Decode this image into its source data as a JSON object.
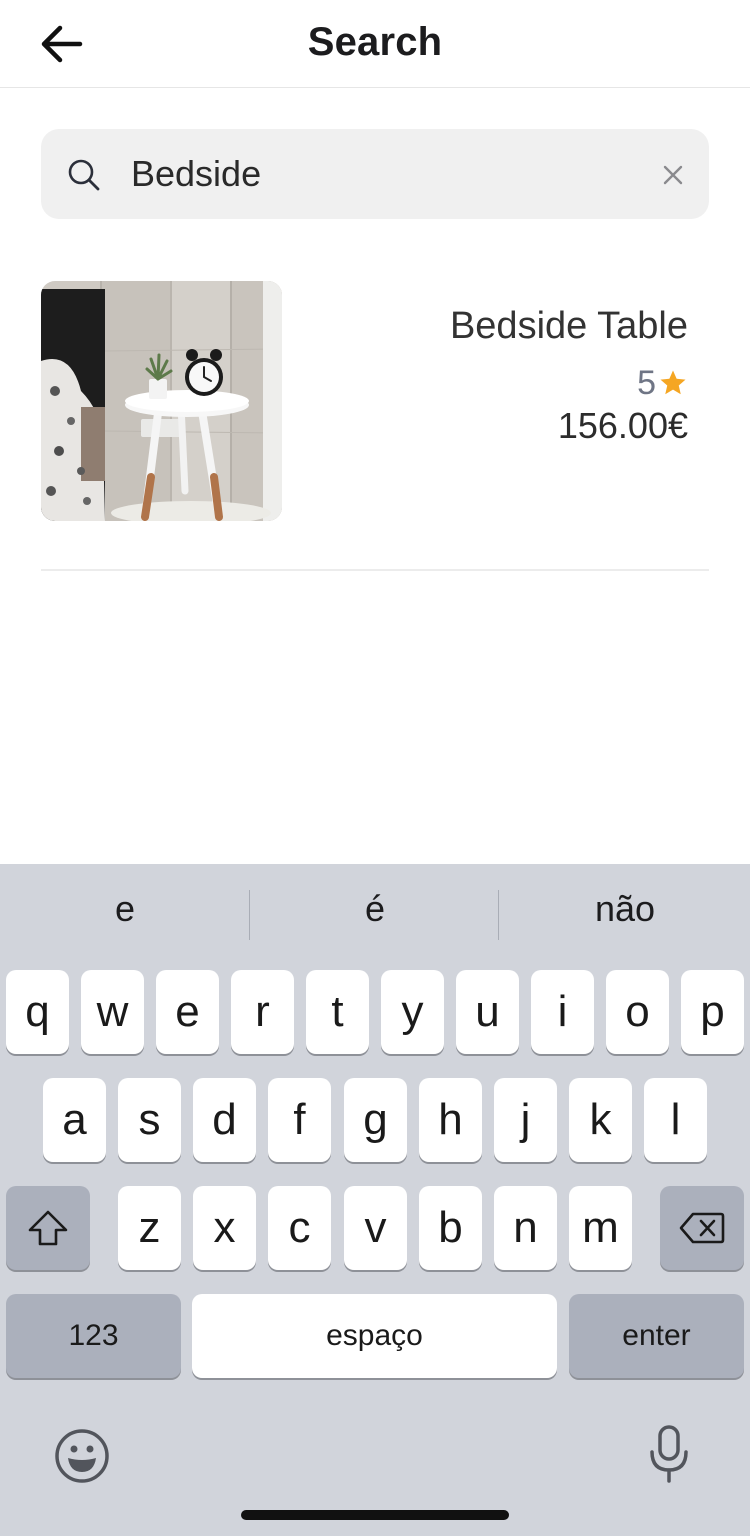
{
  "header": {
    "title": "Search",
    "back_icon": "arrow-left-icon"
  },
  "search": {
    "value": "Bedside",
    "search_icon": "search-icon",
    "clear_icon": "close-icon"
  },
  "results": [
    {
      "name": "Bedside Table",
      "rating": "5",
      "rating_icon": "star-icon",
      "price": "156.00€",
      "image": "bedside-table-photo"
    }
  ],
  "keyboard": {
    "suggestions": [
      "e",
      "é",
      "não"
    ],
    "row1": [
      "q",
      "w",
      "e",
      "r",
      "t",
      "y",
      "u",
      "i",
      "o",
      "p"
    ],
    "row2": [
      "a",
      "s",
      "d",
      "f",
      "g",
      "h",
      "j",
      "k",
      "l"
    ],
    "row3": [
      "z",
      "x",
      "c",
      "v",
      "b",
      "n",
      "m"
    ],
    "numbers_label": "123",
    "space_label": "espaço",
    "enter_label": "enter",
    "shift_icon": "shift-icon",
    "backspace_icon": "backspace-icon",
    "emoji_icon": "emoji-icon",
    "mic_icon": "microphone-icon"
  },
  "colors": {
    "accent_star": "#f5a623",
    "keyboard_bg": "#d1d4db",
    "search_bg": "#f0f0f0"
  }
}
